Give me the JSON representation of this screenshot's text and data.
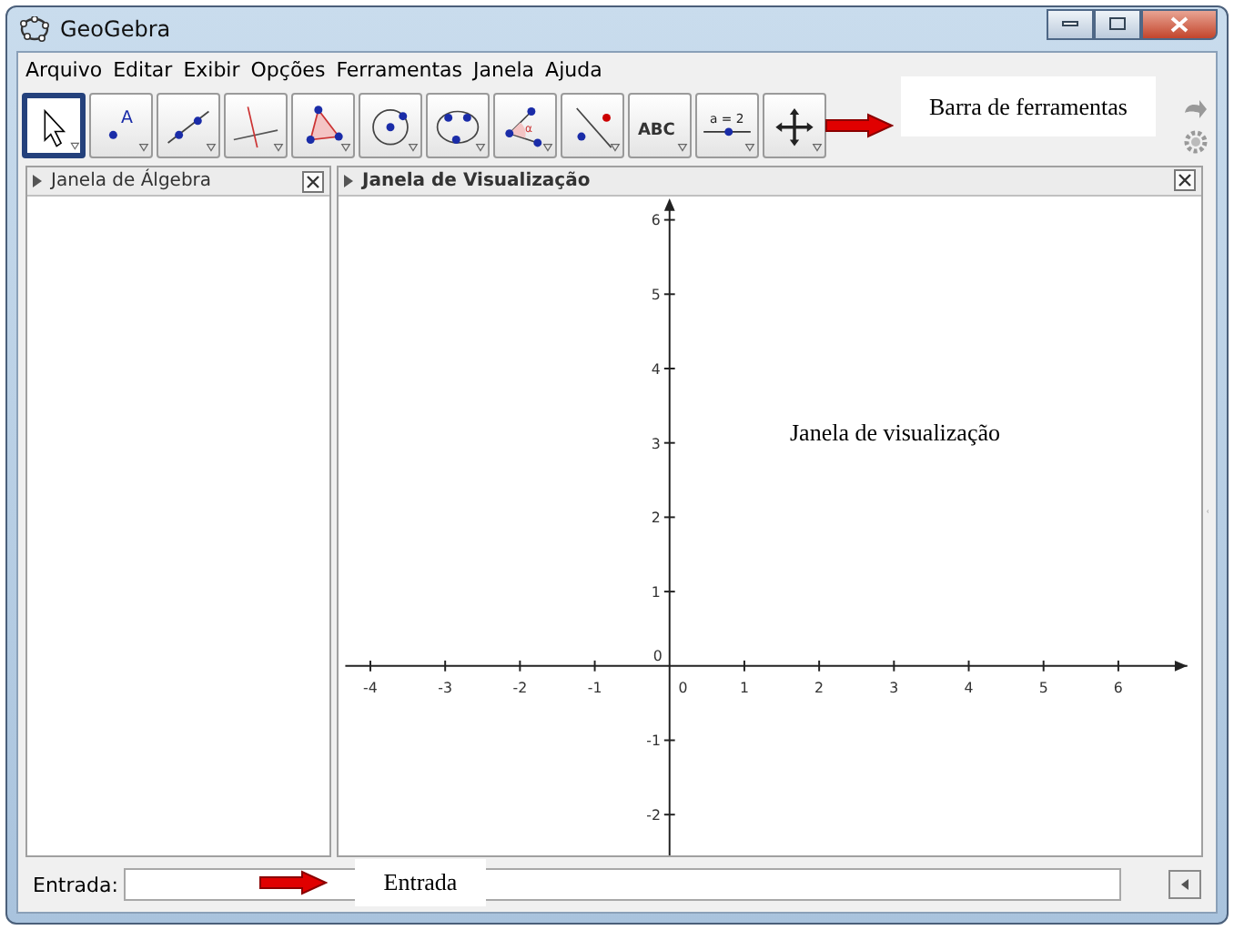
{
  "window": {
    "title": "GeoGebra"
  },
  "menu": [
    "Arquivo",
    "Editar",
    "Exibir",
    "Opções",
    "Ferramentas",
    "Janela",
    "Ajuda"
  ],
  "toolbar": [
    {
      "kind": "move",
      "selected": true
    },
    {
      "kind": "point",
      "label": "A",
      "selected": false
    },
    {
      "kind": "line",
      "selected": false
    },
    {
      "kind": "perpendicular",
      "selected": false
    },
    {
      "kind": "polygon",
      "selected": false
    },
    {
      "kind": "circle",
      "selected": false
    },
    {
      "kind": "conic",
      "selected": false
    },
    {
      "kind": "angle",
      "label": "α",
      "selected": false
    },
    {
      "kind": "reflect",
      "selected": false
    },
    {
      "kind": "text",
      "label": "ABC",
      "selected": false
    },
    {
      "kind": "slider",
      "label": "a = 2",
      "selected": false
    },
    {
      "kind": "move_view",
      "selected": false
    }
  ],
  "algebra_panel": {
    "title": "Janela de Álgebra"
  },
  "graphics_panel": {
    "title": "Janela de Visualização",
    "x_ticks": [
      "-4",
      "-3",
      "-2",
      "-1",
      "1",
      "2",
      "3",
      "4",
      "5",
      "6"
    ],
    "y_ticks": [
      "6",
      "5",
      "4",
      "3",
      "2",
      "1",
      "-1",
      "-2"
    ],
    "origin_labels": [
      "0",
      "0"
    ]
  },
  "input_bar": {
    "label": "Entrada:"
  },
  "annotations": [
    {
      "kind": "callout",
      "text": "Barra de ferramentas"
    },
    {
      "kind": "note",
      "text": "Janela de visualização"
    },
    {
      "kind": "callout",
      "text": "Entrada"
    }
  ]
}
